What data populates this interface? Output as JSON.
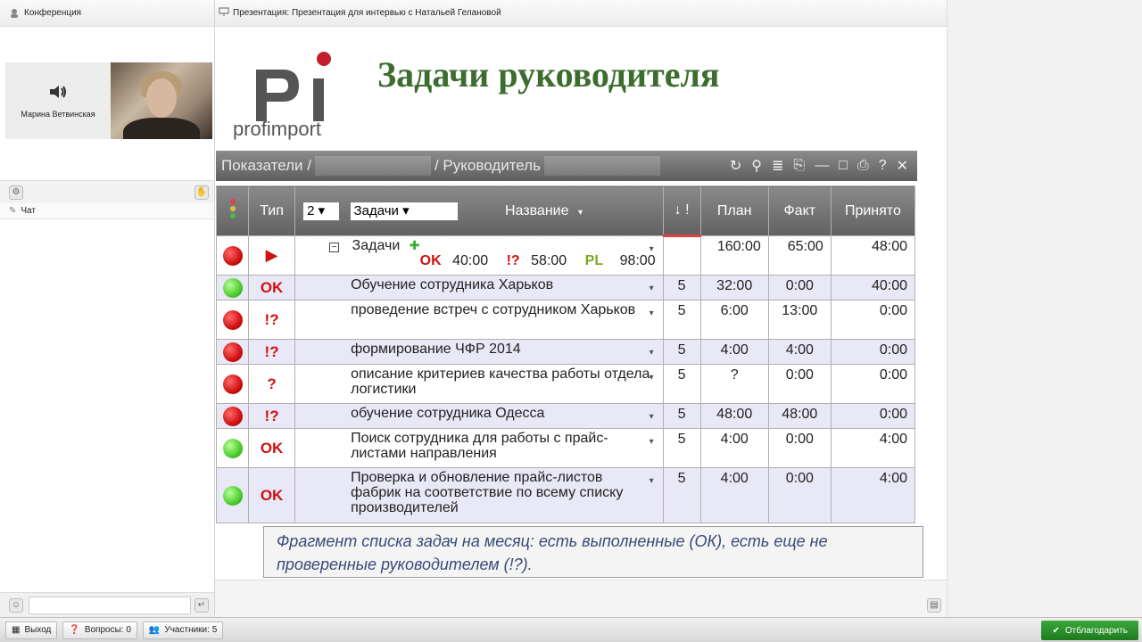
{
  "left_panel": {
    "conference_title": "Конференция",
    "participant_name": "Марина Ветвинская",
    "chat_title": "Чат"
  },
  "presentation": {
    "header_title": "Презентация: Презентация для интервью с Натальей Гелановой",
    "slide_title": "Задачи руководителя",
    "logo_text": "profimport",
    "app_bar": {
      "seg1": "Показатели /",
      "seg2": "/ Руководитель"
    },
    "grid": {
      "headers": {
        "type": "Тип",
        "level_select": "2",
        "tasks_select": "Задачи",
        "name": "Название",
        "sort": "↓ !",
        "plan": "План",
        "fact": "Факт",
        "accepted": "Принято"
      },
      "summary": {
        "name": "Задачи",
        "ok_label": "OK",
        "ok_value": "40:00",
        "q_label": "!?",
        "q_value": "58:00",
        "pl_label": "PL",
        "pl_value": "98:00",
        "plan": "160:00",
        "fact": "65:00",
        "accepted": "48:00"
      },
      "rows": [
        {
          "light": "green",
          "type": "OK",
          "name": "Обучение сотрудника Харьков",
          "priority": "5",
          "plan": "32:00",
          "fact": "0:00",
          "accepted": "40:00"
        },
        {
          "light": "red",
          "type": "!?",
          "name": "проведение встреч с сотрудником Харьков",
          "priority": "5",
          "plan": "6:00",
          "fact": "13:00",
          "accepted": "0:00"
        },
        {
          "light": "red",
          "type": "!?",
          "name": "формирование ЧФР 2014",
          "priority": "5",
          "plan": "4:00",
          "fact": "4:00",
          "accepted": "0:00"
        },
        {
          "light": "red",
          "type": "?",
          "name": "описание критериев качества работы отдела логистики",
          "priority": "5",
          "plan": "?",
          "fact": "0:00",
          "accepted": "0:00"
        },
        {
          "light": "red",
          "type": "!?",
          "name": "обучение сотрудника Одесса",
          "priority": "5",
          "plan": "48:00",
          "fact": "48:00",
          "accepted": "0:00"
        },
        {
          "light": "green",
          "type": "OK",
          "name": "Поиск сотрудника для работы с прайс-листами направления",
          "priority": "5",
          "plan": "4:00",
          "fact": "0:00",
          "accepted": "4:00"
        },
        {
          "light": "green",
          "type": "OK",
          "name": "Проверка и обновление прайс-листов фабрик на соответствие по всему списку производителей",
          "priority": "5",
          "plan": "4:00",
          "fact": "0:00",
          "accepted": "4:00"
        }
      ]
    },
    "caption": "Фрагмент списка задач на месяц: есть выполненные (ОК), есть еще не проверенные руководителем (!?)."
  },
  "status_bar": {
    "exit": "Выход",
    "questions": "Вопросы: 0",
    "participants": "Участники: 5",
    "thank": "Отблагодарить"
  },
  "colors": {
    "title_green": "#3c6d2e",
    "status_red": "#d01010",
    "status_green": "#4ccc2c",
    "caption_blue": "#3a4a78"
  }
}
